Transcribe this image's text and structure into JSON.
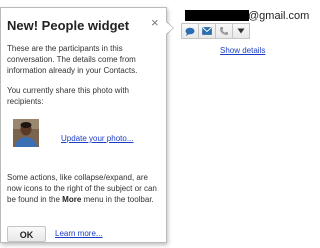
{
  "popup": {
    "title": "New! People widget",
    "close_glyph": "×",
    "intro": "These are the participants in this conversation. The details come from information already in your Contacts.",
    "share_text": "You currently share this photo with recipients:",
    "update_photo_link": "Update your photo...",
    "actions_pre": "Some actions, like collapse/expand, are now icons to the right of the subject or can be found in the ",
    "actions_bold": "More",
    "actions_post": " menu in the toolbar.",
    "ok_label": "OK",
    "learn_more_link": "Learn more..."
  },
  "widget": {
    "email_domain": "@gmail.com",
    "show_details_link": "Show details",
    "actions": [
      {
        "icon": "chat-icon"
      },
      {
        "icon": "mail-icon"
      },
      {
        "icon": "phone-icon"
      },
      {
        "icon": "dropdown-arrow-icon"
      }
    ]
  },
  "colors": {
    "link": "#1a3cc6",
    "chat_icon": "#2a6db0",
    "mail_icon": "#2a6db0",
    "phone_icon": "#999999"
  }
}
